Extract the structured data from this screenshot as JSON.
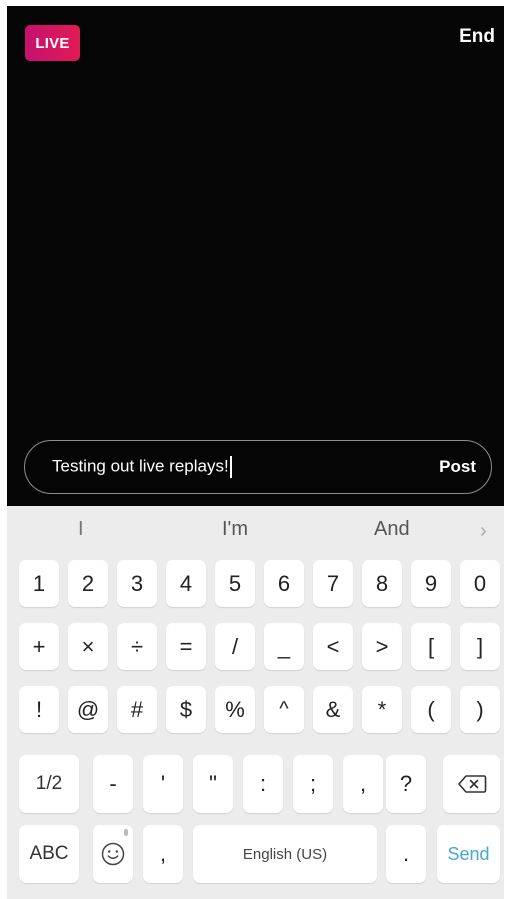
{
  "live": {
    "badge": "LIVE",
    "end_label": "End"
  },
  "comment": {
    "text": "Testing out live replays!",
    "post_label": "Post"
  },
  "keyboard": {
    "suggestions": [
      "I",
      "I'm",
      "And"
    ],
    "more_suggestions_icon": "chevron-right-icon",
    "row1": [
      "1",
      "2",
      "3",
      "4",
      "5",
      "6",
      "7",
      "8",
      "9",
      "0"
    ],
    "row2": [
      "+",
      "×",
      "÷",
      "=",
      "/",
      "_",
      "<",
      ">",
      "[",
      "]"
    ],
    "row3": [
      "!",
      "@",
      "#",
      "$",
      "%",
      "^",
      "&",
      "*",
      "(",
      ")"
    ],
    "row4": {
      "page_toggle": "1/2",
      "keys": [
        "-",
        "'",
        "\"",
        ":",
        ";",
        ",",
        "?"
      ],
      "backspace_icon": "backspace-icon"
    },
    "row5": {
      "abc": "ABC",
      "emoji_icon": "emoji-icon",
      "comma": ",",
      "space_label": "English (US)",
      "period": ".",
      "send_label": "Send"
    }
  },
  "colors": {
    "live_badge_start": "#c5126e",
    "live_badge_end": "#e21a55",
    "send_accent": "#48a6d3",
    "keyboard_bg": "#ececec"
  }
}
